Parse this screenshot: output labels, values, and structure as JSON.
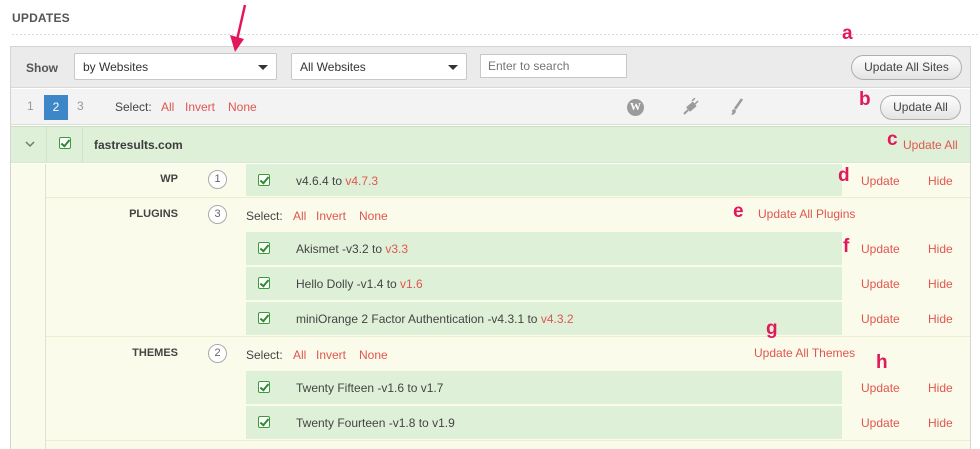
{
  "page_title": "UPDATES",
  "toolbar": {
    "show_label": "Show",
    "view_select": "by Websites",
    "sites_select": "All Websites",
    "search_placeholder": "Enter to search",
    "update_all_sites": "Update All Sites"
  },
  "pager": {
    "pages": [
      "1",
      "2",
      "3"
    ],
    "active_page": "2",
    "select_label": "Select:",
    "all": "All",
    "invert": "Invert",
    "none": "None",
    "filter_icons": [
      "wordpress-icon",
      "plugin-icon",
      "theme-brush-icon"
    ],
    "update_all": "Update All"
  },
  "site": {
    "name": "fastresults.com",
    "update_all": "Update All"
  },
  "sections": {
    "wp": {
      "label": "WP",
      "count": "1",
      "item_prefix": "v4.6.4 to ",
      "item_version": "v4.7.3",
      "update": "Update",
      "hide": "Hide"
    },
    "plugins": {
      "label": "PLUGINS",
      "count": "3",
      "select_label": "Select:",
      "all": "All",
      "invert": "Invert",
      "none": "None",
      "update_all": "Update All Plugins",
      "items": [
        {
          "prefix": "Akismet -v3.2 to ",
          "version": "v3.3",
          "update": "Update",
          "hide": "Hide"
        },
        {
          "prefix": "Hello Dolly -v1.4 to ",
          "version": "v1.6",
          "update": "Update",
          "hide": "Hide"
        },
        {
          "prefix": "miniOrange 2 Factor Authentication -v4.3.1 to ",
          "version": "v4.3.2",
          "update": "Update",
          "hide": "Hide"
        }
      ]
    },
    "themes": {
      "label": "THEMES",
      "count": "2",
      "select_label": "Select:",
      "all": "All",
      "invert": "Invert",
      "none": "None",
      "update_all": "Update All Themes",
      "items": [
        {
          "text": "Twenty Fifteen -v1.6 to v1.7",
          "update": "Update",
          "hide": "Hide"
        },
        {
          "text": "Twenty Fourteen -v1.8 to v1.9",
          "update": "Update",
          "hide": "Hide"
        }
      ]
    }
  },
  "annotations": [
    "a",
    "b",
    "c",
    "d",
    "e",
    "f",
    "g",
    "h"
  ],
  "colors": {
    "accent_red": "#e0564f",
    "annotation_pink": "#e2185c",
    "row_green": "#dff0d8",
    "pager_blue": "#3d87c8"
  }
}
